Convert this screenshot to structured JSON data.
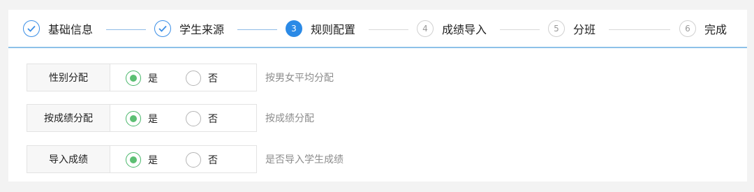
{
  "steps": [
    {
      "label": "基础信息",
      "number": "",
      "state": "done",
      "icon": "check-icon"
    },
    {
      "label": "学生来源",
      "number": "",
      "state": "done",
      "icon": "check-icon"
    },
    {
      "label": "规则配置",
      "number": "3",
      "state": "active"
    },
    {
      "label": "成绩导入",
      "number": "4",
      "state": "todo"
    },
    {
      "label": "分班",
      "number": "5",
      "state": "todo"
    },
    {
      "label": "完成",
      "number": "6",
      "state": "todo"
    }
  ],
  "rules": [
    {
      "label": "性别分配",
      "yes": "是",
      "no": "否",
      "selected": "yes",
      "description": "按男女平均分配"
    },
    {
      "label": "按成绩分配",
      "yes": "是",
      "no": "否",
      "selected": "yes",
      "description": "按成绩分配"
    },
    {
      "label": "导入成绩",
      "yes": "是",
      "no": "否",
      "selected": "yes",
      "description": "是否导入学生成绩"
    }
  ],
  "colors": {
    "accent": "#2b8ae6",
    "radio_selected": "#5cbf73",
    "background": "#f3f3f3"
  }
}
